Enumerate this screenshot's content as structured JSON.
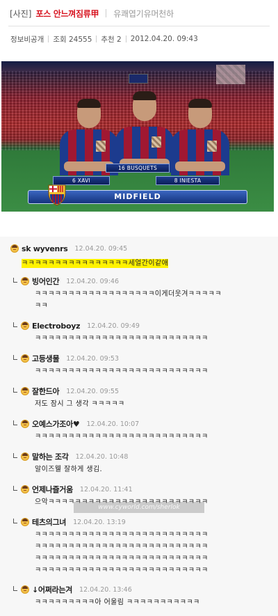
{
  "header": {
    "category": "[사진]",
    "title": "포스 안느껴짐류甲",
    "subtitle": "유쾌엽기유머천하",
    "meta": {
      "visibility": "정보비공개",
      "views": "조회 24555",
      "recommend": "추천 2",
      "datetime": "2012.04.20. 09:43"
    }
  },
  "photo": {
    "players": [
      {
        "plate": "6 XAVI"
      },
      {
        "plate": "16 BUSQUETS"
      },
      {
        "plate": "8 INIESTA"
      }
    ],
    "banner": "MIDFIELD"
  },
  "comments": [
    {
      "nick": "sk wyvenrs",
      "date": "12.04.20. 09:45",
      "reply": false,
      "lines": [
        "ㅋㅋㅋㅋㅋㅋㅋㅋㅋㅋㅋㅋㅋㅋㅋㅋ세얼간이같애"
      ]
    },
    {
      "nick": "빙어인간",
      "date": "12.04.20. 09:46",
      "reply": true,
      "lines": [
        "ㅋㅋㅋㅋㅋㅋㅋㅋㅋㅋㅋㅋㅋㅋㅋㅋㅋㅋ이게더웃겨ㅋㅋㅋㅋㅋ",
        "ㅋㅋ"
      ]
    },
    {
      "nick": "Electroboyz",
      "date": "12.04.20. 09:49",
      "reply": true,
      "lines": [
        "ㅋㅋㅋㅋㅋㅋㅋㅋㅋㅋㅋㅋㅋㅋㅋㅋㅋㅋㅋㅋㅋㅋㅋㅋㅋㅋ"
      ]
    },
    {
      "nick": "고등생물",
      "date": "12.04.20. 09:53",
      "reply": true,
      "lines": [
        "ㅋㅋㅋㅋㅋㅋㅋㅋㅋㅋㅋㅋㅋㅋㅋㅋㅋㅋㅋㅋㅋㅋㅋㅋㅋㅋ"
      ]
    },
    {
      "nick": "잘한드아",
      "date": "12.04.20. 09:55",
      "reply": true,
      "lines": [
        "저도 잠시 그 생각 ㅋㅋㅋㅋㅋ"
      ]
    },
    {
      "nick": "오예스가조아♥",
      "date": "12.04.20. 10:07",
      "reply": true,
      "lines": [
        "ㅋㅋㅋㅋㅋㅋㅋㅋㅋㅋㅋㅋㅋㅋㅋㅋㅋㅋㅋㅋㅋㅋㅋㅋㅋㅋ"
      ]
    },
    {
      "nick": "말하는 조각",
      "date": "12.04.20. 10:48",
      "reply": true,
      "lines": [
        "알이즈웰 잘하게 생김."
      ]
    },
    {
      "nick": "언제나즐거움",
      "date": "12.04.20. 11:41",
      "reply": true,
      "lines": [
        "으악ㅋㅋㅋㅋㅋㅋㅋㅋㅋㅋㅋㅋㅋㅋㅋㅋㅋㅋㅋㅋㅋㅋㅋㅋ"
      ]
    },
    {
      "nick": "테츠의그녀",
      "date": "12.04.20. 13:19",
      "reply": true,
      "lines": [
        "ㅋㅋㅋㅋㅋㅋㅋㅋㅋㅋㅋㅋㅋㅋㅋㅋㅋㅋㅋㅋㅋㅋㅋㅋㅋㅋ",
        "ㅋㅋㅋㅋㅋㅋㅋㅋㅋㅋㅋㅋㅋㅋㅋㅋㅋㅋㅋㅋㅋㅋㅋㅋㅋㅋ",
        "ㅋㅋㅋㅋㅋㅋㅋㅋㅋㅋㅋㅋㅋㅋㅋㅋㅋㅋㅋㅋㅋㅋㅋㅋㅋㅋ",
        "ㅋㅋㅋㅋㅋㅋㅋㅋㅋㅋㅋㅋㅋㅋㅋㅋㅋㅋㅋㅋㅋㅋㅋㅋㅋㅋ"
      ]
    },
    {
      "nick": "↓어쩌라는겨",
      "date": "12.04.20. 13:46",
      "reply": true,
      "lines": [
        "ㅋㅋㅋㅋㅋㅋㅋㅋㅋ아 어울림 ㅋㅋㅋㅋㅋㅋㅋㅋㅋㅋㅋ"
      ]
    }
  ],
  "watermark": "www.cyworld.com/sherlok",
  "colors": {
    "title": "#d7131f",
    "highlight": "#fff200",
    "comment_bg": "#f7f7f7"
  }
}
